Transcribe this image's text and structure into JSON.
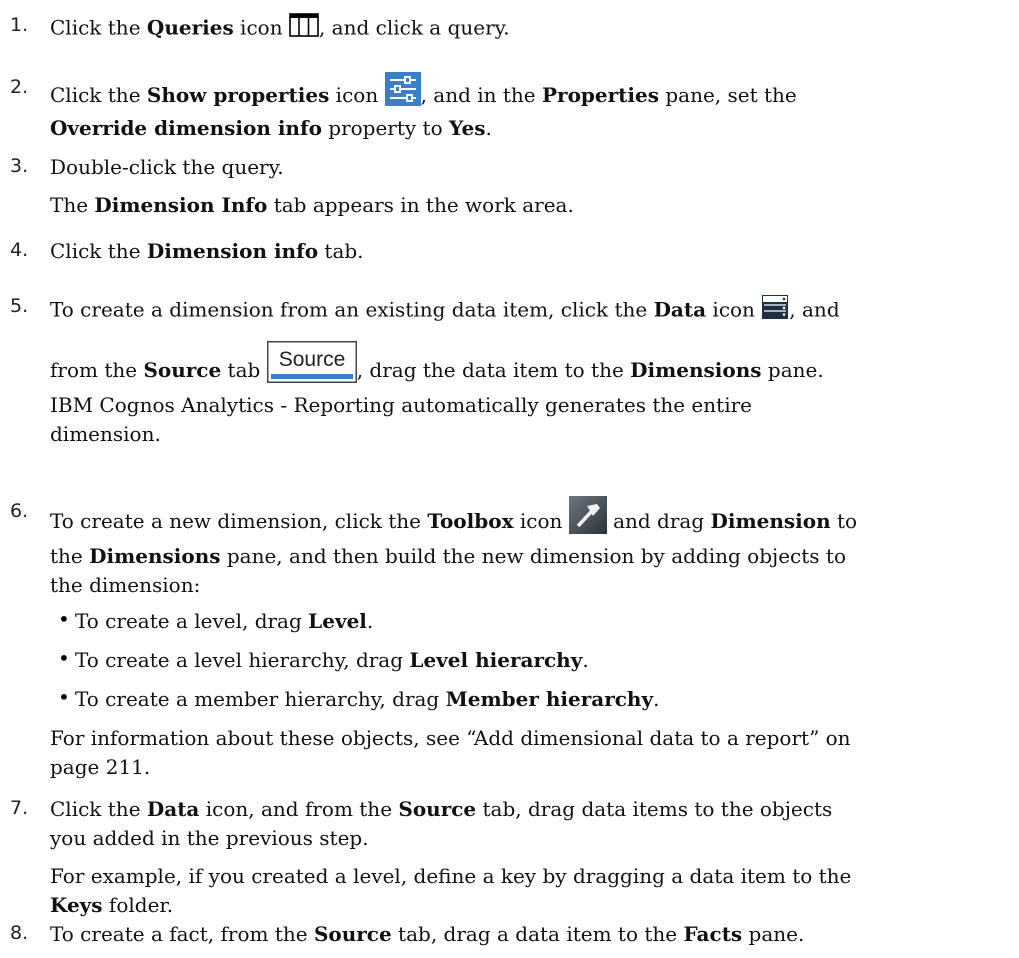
{
  "steps": [
    {
      "n": "1.",
      "parts": [
        "Click the ",
        "Queries",
        " icon ",
        ", and click a query."
      ]
    },
    {
      "n": "2.",
      "parts": [
        "Click the ",
        "Show properties",
        " icon ",
        ", and in the ",
        "Properties",
        " pane, set the ",
        "Override dimension info",
        " property to ",
        "Yes",
        "."
      ]
    },
    {
      "n": "3.",
      "parts": [
        "Double-click the query.",
        "The ",
        "Dimension Info",
        " tab appears in the work area."
      ]
    },
    {
      "n": "4.",
      "parts": [
        "Click the ",
        "Dimension info",
        " tab."
      ]
    },
    {
      "n": "5.",
      "parts": [
        "To create a dimension from an existing data item, click the ",
        "Data",
        " icon ",
        ", and",
        "from the ",
        "Source",
        " tab ",
        ", drag the data item to the ",
        "Dimensions",
        " pane.",
        "IBM Cognos Analytics - Reporting automatically generates the entire",
        "dimension."
      ]
    },
    {
      "n": "6.",
      "parts": [
        "To create a new dimension, click the ",
        "Toolbox",
        " icon ",
        " and drag ",
        "Dimension",
        " to",
        "the ",
        "Dimensions",
        " pane, and then build the new dimension by adding objects to",
        "the dimension:"
      ]
    },
    {
      "n": "7.",
      "parts": [
        "Click the ",
        "Data",
        " icon, and from the ",
        "Source",
        " tab, drag data items to the objects",
        "you added in the previous step.",
        "For example, if you created a level, define a key by dragging a data item to the",
        "Keys",
        " folder."
      ]
    },
    {
      "n": "8.",
      "parts": [
        "To create a fact, from the ",
        "Source",
        " tab, drag a data item to the ",
        "Facts",
        " pane."
      ]
    }
  ],
  "bullets": [
    {
      "parts": [
        "To create a level, drag ",
        "Level",
        "."
      ]
    },
    {
      "parts": [
        "To create a level hierarchy, drag ",
        "Level hierarchy",
        "."
      ]
    },
    {
      "parts": [
        "To create a member hierarchy, drag ",
        "Member hierarchy",
        "."
      ]
    }
  ],
  "note6": [
    "For information about these objects, see “Add dimensional data to a report” on",
    "page 211."
  ],
  "source_tab_label": "Source",
  "icons": {
    "queries": "queries-icon",
    "properties": "show-properties-icon",
    "data": "data-icon",
    "source_tab": "source-tab-icon",
    "toolbox": "toolbox-hammer-icon"
  },
  "colors": {
    "accent_blue": "#3d7fc7",
    "dark_icon": "#1f2f44"
  }
}
